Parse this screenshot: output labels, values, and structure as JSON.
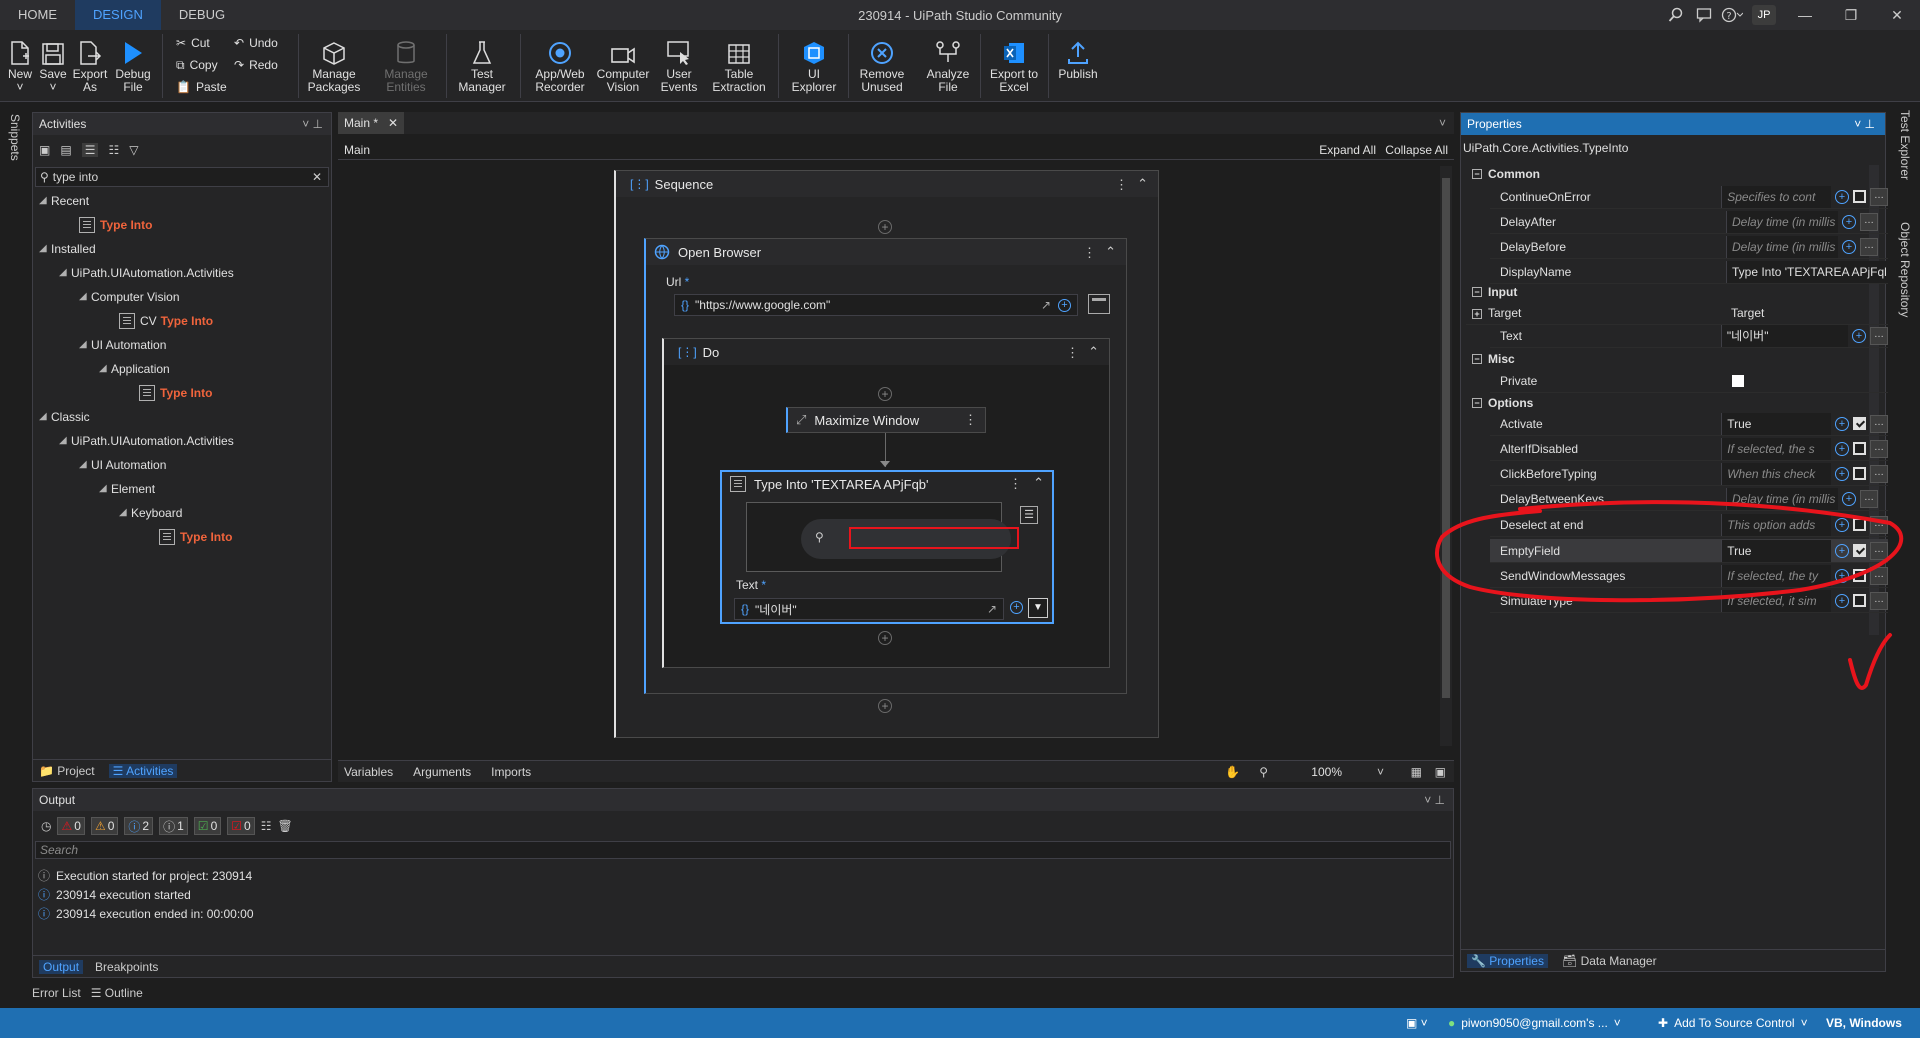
{
  "window": {
    "title": "230914 - UiPath Studio Community",
    "user_initials": "JP"
  },
  "top_tabs": [
    {
      "label": "HOME"
    },
    {
      "label": "DESIGN"
    },
    {
      "label": "DEBUG"
    }
  ],
  "ribbon": {
    "new": "New",
    "save": "Save",
    "export_as": "Export As",
    "debug_file": "Debug File",
    "cut": "Cut",
    "copy": "Copy",
    "paste": "Paste",
    "undo": "Undo",
    "redo": "Redo",
    "manage_packages": "Manage Packages",
    "manage_entities": "Manage Entities",
    "test_manager": "Test Manager",
    "app_web_recorder": "App/Web Recorder",
    "computer_vision": "Computer Vision",
    "user_events": "User Events",
    "table_extraction": "Table Extraction",
    "ui_explorer": "UI Explorer",
    "remove_unused": "Remove Unused",
    "analyze_file": "Analyze File",
    "export_to_excel": "Export to Excel",
    "publish": "Publish"
  },
  "left_side_tab": "Snippets",
  "activities": {
    "title": "Activities",
    "search_value": "type into",
    "tree": {
      "recent": "Recent",
      "recent_item": "Type Into",
      "installed": "Installed",
      "uia": "UiPath.UIAutomation.Activities",
      "computer_vision": "Computer Vision",
      "cv_prefix": "CV",
      "cv_item": "Type Into",
      "ui_automation": "UI Automation",
      "application": "Application",
      "app_item": "Type Into",
      "classic": "Classic",
      "classic_uia": "UiPath.UIAutomation.Activities",
      "classic_ui_automation": "UI Automation",
      "element": "Element",
      "keyboard": "Keyboard",
      "keyboard_item": "Type Into"
    },
    "bottom_tabs": {
      "project": "Project",
      "activities": "Activities"
    }
  },
  "designer": {
    "tab": "Main *",
    "breadcrumb": "Main",
    "expand_all": "Expand All",
    "collapse_all": "Collapse All",
    "sequence": "Sequence",
    "open_browser": "Open Browser",
    "url_label": "Url",
    "url_value": "\"https://www.google.com\"",
    "do": "Do",
    "maximize_window": "Maximize Window",
    "type_into": "Type Into 'TEXTAREA  APjFqb'",
    "text_label": "Text",
    "text_value": "\"네이버\"",
    "bottom_tabs": {
      "variables": "Variables",
      "arguments": "Arguments",
      "imports": "Imports"
    },
    "zoom": "100%"
  },
  "properties": {
    "title": "Properties",
    "class_name": "UiPath.Core.Activities.TypeInto",
    "categories": {
      "common": "Common",
      "input": "Input",
      "misc": "Misc",
      "options": "Options"
    },
    "rows": {
      "continue_on_error": {
        "name": "ContinueOnError",
        "value": "Specifies to cont"
      },
      "delay_after": {
        "name": "DelayAfter",
        "value": "Delay time (in millis"
      },
      "delay_before": {
        "name": "DelayBefore",
        "value": "Delay time (in millis"
      },
      "display_name": {
        "name": "DisplayName",
        "value": "Type Into 'TEXTAREA  APjFqb'"
      },
      "target": {
        "name": "Target",
        "value": "Target"
      },
      "text": {
        "name": "Text",
        "value": "\"네이버\""
      },
      "private": {
        "name": "Private"
      },
      "activate": {
        "name": "Activate",
        "value": "True"
      },
      "alter_if_disabled": {
        "name": "AlterIfDisabled",
        "value": "If selected, the s"
      },
      "click_before_typing": {
        "name": "ClickBeforeTyping",
        "value": "When this check"
      },
      "delay_between_keys": {
        "name": "DelayBetweenKeys",
        "value": "Delay time (in millis"
      },
      "deselect_at_end": {
        "name": "Deselect at end",
        "value": "This option adds"
      },
      "empty_field": {
        "name": "EmptyField",
        "value": "True"
      },
      "send_window_messages": {
        "name": "SendWindowMessages",
        "value": "If selected, the ty"
      },
      "simulate_type": {
        "name": "SimulateType",
        "value": "If selected, it sim"
      }
    },
    "bottom_tabs": {
      "properties": "Properties",
      "data_manager": "Data Manager"
    }
  },
  "right_side_tabs": {
    "test_explorer": "Test Explorer",
    "object_repository": "Object Repository"
  },
  "output": {
    "title": "Output",
    "badges": {
      "errors": "0",
      "warnings": "0",
      "info": "2",
      "trace": "1",
      "success": "0",
      "fail": "0"
    },
    "search_placeholder": "Search",
    "lines": [
      "Execution started for project: 230914",
      "230914 execution started",
      "230914 execution ended in: 00:00:00"
    ],
    "bottom_tabs": {
      "output": "Output",
      "breakpoints": "Breakpoints"
    }
  },
  "footer_tabs": {
    "error_list": "Error List",
    "outline": "Outline"
  },
  "status": {
    "account": "piwon9050@gmail.com's ...",
    "source_control": "Add To Source Control",
    "project_type": "VB, Windows"
  },
  "colors": {
    "accent": "#1f6fb2",
    "highlight": "#f0643c",
    "annotation": "#e8141c"
  }
}
